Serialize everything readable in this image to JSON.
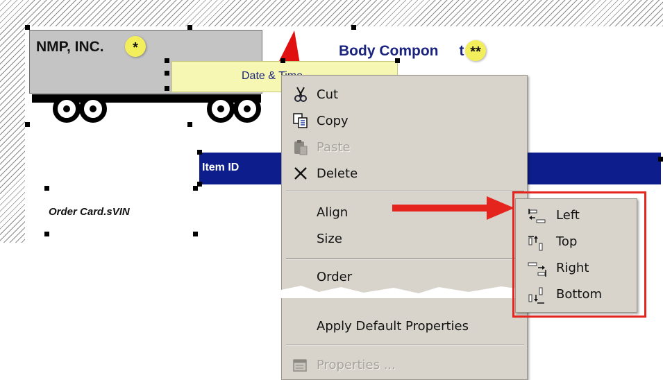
{
  "report": {
    "company_name": "NMP, INC.",
    "star_single": "*",
    "title": "Body Compon",
    "title_tail": "t",
    "star_double": "**",
    "date_field": "Date & Time",
    "item_id_label": "Item ID",
    "order_card_field": "Order Card.sVIN"
  },
  "context_menu": {
    "items": [
      {
        "label": "Cut",
        "icon": "scissors-icon",
        "enabled": true
      },
      {
        "label": "Copy",
        "icon": "copy-icon",
        "enabled": true
      },
      {
        "label": "Paste",
        "icon": "paste-icon",
        "enabled": false
      },
      {
        "label": "Delete",
        "icon": "delete-x-icon",
        "enabled": true
      },
      {
        "label": "Align",
        "has_submenu": true,
        "enabled": true
      },
      {
        "label": "Size",
        "has_submenu": true,
        "enabled": true
      },
      {
        "label": "Order",
        "has_submenu": true,
        "enabled": true
      },
      {
        "label": "Apply Default Properties",
        "enabled": true
      },
      {
        "label": "Properties ...",
        "icon": "properties-icon",
        "enabled": false
      }
    ]
  },
  "align_submenu": {
    "items": [
      {
        "label": "Left",
        "icon": "align-left-icon"
      },
      {
        "label": "Top",
        "icon": "align-top-icon"
      },
      {
        "label": "Right",
        "icon": "align-right-icon"
      },
      {
        "label": "Bottom",
        "icon": "align-bottom-icon"
      }
    ]
  },
  "colors": {
    "highlight": "#e5251d",
    "menu_bg": "#d8d4cc",
    "item_bar": "#0d1e8c",
    "date_field_bg": "#f7f7b4"
  }
}
